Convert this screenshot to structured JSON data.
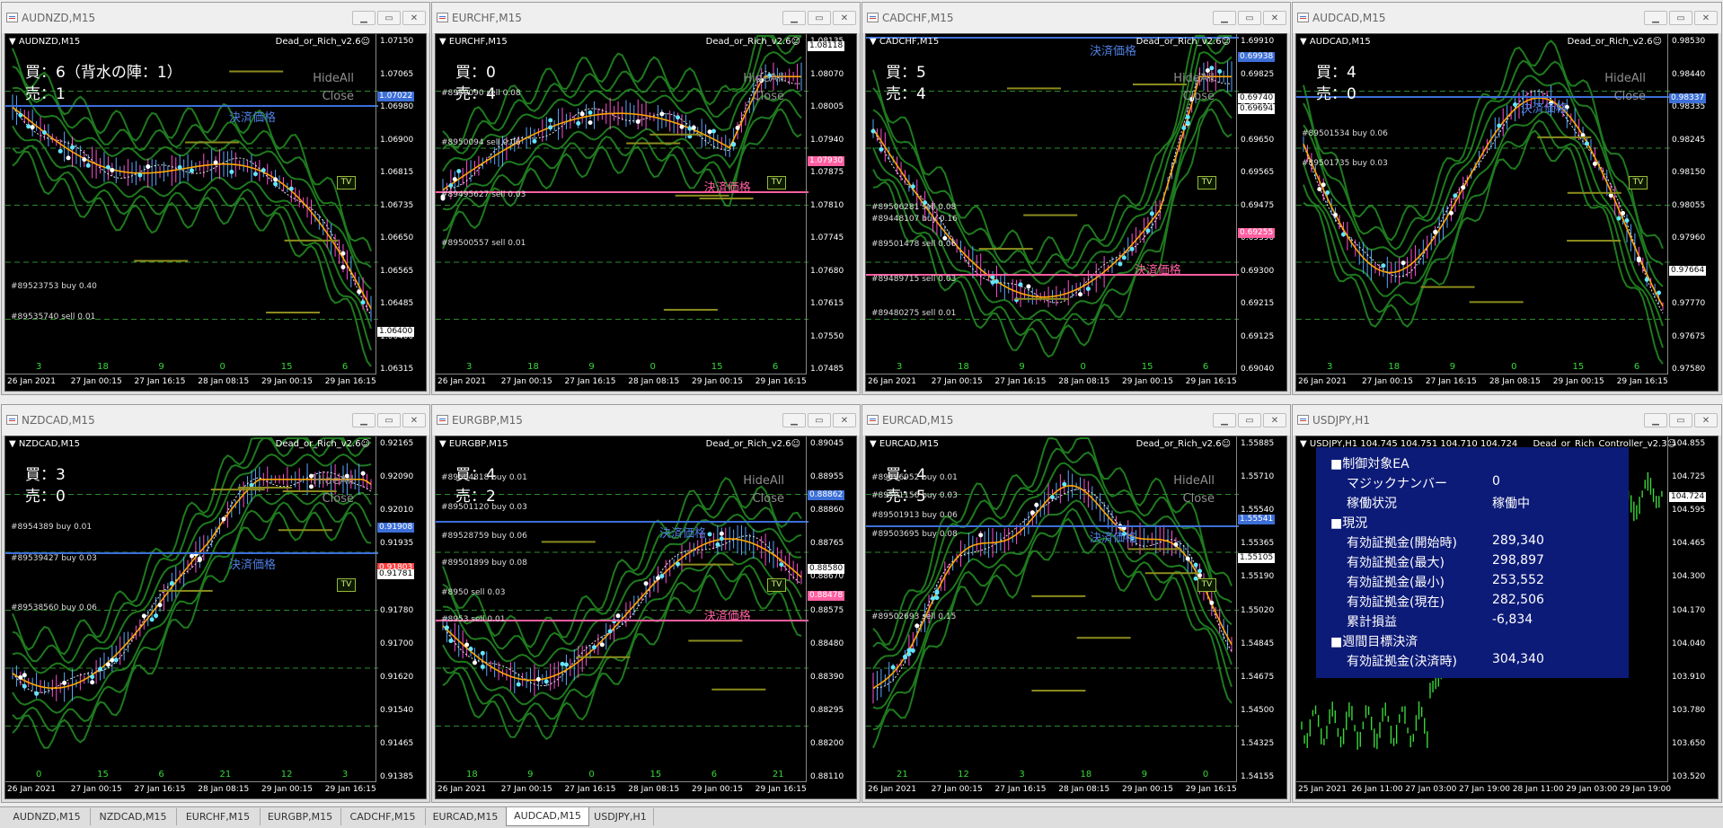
{
  "windows": [
    {
      "key": "w1",
      "title": "AUDNZD,M15",
      "symbol": "AUDNZD,M15",
      "ea": "Dead_or_Rich_v2.6☺",
      "buy": "買：6（背水の陣：1）",
      "sell": "売：1",
      "hide_all": "HideAll",
      "close": "Close",
      "tv": "TV",
      "settle_label": "決済価格",
      "pink_label": "",
      "orders": [
        "#89523753 buy 0.40",
        "#89535740 sell 0.01"
      ],
      "price_ticks": [
        "1.07150",
        "1.07065",
        "1.06980",
        "1.06900",
        "1.06815",
        "1.06735",
        "1.06650",
        "1.06565",
        "1.06485",
        "1.06400",
        "1.06315"
      ],
      "tags": [
        {
          "text": "1.07022",
          "color": "#3c6fd8"
        },
        {
          "text": "1.06400",
          "color": "#ffffff"
        }
      ],
      "hnums": [
        "3",
        "18",
        "9",
        "0",
        "15",
        "6"
      ],
      "dates": [
        "26 Jan 2021",
        "27 Jan 00:15",
        "27 Jan 16:15",
        "28 Jan 08:15",
        "29 Jan 00:15",
        "29 Jan 16:15"
      ],
      "trend": "down"
    },
    {
      "key": "w2",
      "title": "EURCHF,M15",
      "symbol": "EURCHF,M15",
      "ea": "Dead_or_Rich_v2.6☺",
      "buy": "買：0",
      "sell": "売：4",
      "hide_all": "HideAll",
      "close": "Close",
      "tv": "TV",
      "settle_label": "",
      "pink_label": "決済価格",
      "orders": [
        "#8950090 sell 0.08",
        "#8950094 sell 0.06",
        "#89495627 sell 0.03",
        "#89500557 sell 0.01"
      ],
      "price_ticks": [
        "1.08135",
        "1.08070",
        "1.08005",
        "1.07940",
        "1.07875",
        "1.07810",
        "1.07745",
        "1.07680",
        "1.07615",
        "1.07550",
        "1.07485"
      ],
      "tags": [
        {
          "text": "1.08118",
          "color": "#ffffff"
        },
        {
          "text": "1.07930",
          "color": "#ff5fa0"
        }
      ],
      "hnums": [
        "3",
        "18",
        "9",
        "0",
        "15",
        "6"
      ],
      "dates": [
        "26 Jan 2021",
        "27 Jan 00:15",
        "27 Jan 16:15",
        "28 Jan 08:15",
        "29 Jan 00:15",
        "29 Jan 16:15"
      ],
      "trend": "updown"
    },
    {
      "key": "w3",
      "title": "CADCHF,M15",
      "symbol": "CADCHF,M15",
      "ea": "Dead_or_Rich_v2.6☺",
      "buy": "買：5",
      "sell": "売：4",
      "hide_all": "HideAll",
      "close": "Close",
      "tv": "TV",
      "settle_label": "決済価格",
      "pink_label": "決済価格",
      "orders": [
        "#89506281 sell 0.08",
        "#89448107 buy 0.16",
        "#89501478 sell 0.06",
        "#89489715 sell 0.03",
        "#89480275 sell 0.01"
      ],
      "price_ticks": [
        "1.69910",
        "0.69825",
        "0.69740",
        "0.69650",
        "0.69565",
        "0.69475",
        "0.69390",
        "0.69300",
        "0.69215",
        "0.69125",
        "0.69040"
      ],
      "tags": [
        {
          "text": "0.69938",
          "color": "#3c6fd8"
        },
        {
          "text": "0.69740",
          "color": "#ffffff"
        },
        {
          "text": "0.69694",
          "color": "#ffffff"
        },
        {
          "text": "0.69255",
          "color": "#ff5fa0"
        }
      ],
      "hnums": [
        "3",
        "18",
        "9",
        "0",
        "15",
        "6"
      ],
      "dates": [
        "26 Jan 2021",
        "27 Jan 00:15",
        "27 Jan 16:15",
        "28 Jan 08:15",
        "29 Jan 00:15",
        "29 Jan 16:15"
      ],
      "trend": "vshape"
    },
    {
      "key": "w4",
      "title": "AUDCAD,M15",
      "symbol": "AUDCAD,M15",
      "ea": "Dead_or_Rich_v2.6☺",
      "buy": "買：4",
      "sell": "売：0",
      "hide_all": "HideAll",
      "close": "Close",
      "tv": "TV",
      "settle_label": "決済価格",
      "pink_label": "",
      "orders": [
        "#89501534 buy 0.06",
        "#89501735 buy 0.03"
      ],
      "price_ticks": [
        "0.98530",
        "0.98440",
        "0.98335",
        "0.98245",
        "0.98150",
        "0.98055",
        "0.97960",
        "0.97865",
        "0.97770",
        "0.97675",
        "0.97580"
      ],
      "tags": [
        {
          "text": "0.98337",
          "color": "#3c6fd8"
        },
        {
          "text": "0.97664",
          "color": "#ffffff"
        }
      ],
      "hnums": [
        "3",
        "18",
        "9",
        "0",
        "15",
        "6"
      ],
      "dates": [
        "26 Jan 2021",
        "27 Jan 00:15",
        "27 Jan 16:15",
        "28 Jan 08:15",
        "29 Jan 00:15",
        "29 Jan 16:15"
      ],
      "trend": "wave"
    },
    {
      "key": "w5",
      "title": "NZDCAD,M15",
      "symbol": "NZDCAD,M15",
      "ea": "Dead_or_Rich_v2.6☺",
      "buy": "買：3",
      "sell": "売：0",
      "hide_all": "HideAll",
      "close": "Close",
      "tv": "TV",
      "settle_label": "決済価格",
      "pink_label": "",
      "orders": [
        "#8954389 buy 0.01",
        "#89539427 buy 0.03",
        "#89538560 buy 0.06"
      ],
      "price_ticks": [
        "0.92165",
        "0.92090",
        "0.92010",
        "0.91935",
        "0.91855",
        "0.91780",
        "0.91700",
        "0.91620",
        "0.91540",
        "0.91465",
        "0.91385"
      ],
      "tags": [
        {
          "text": "0.91908",
          "color": "#3c6fd8"
        },
        {
          "text": "0.91803",
          "color": "#ff4040"
        },
        {
          "text": "0.91781",
          "color": "#ffffff"
        }
      ],
      "hnums": [
        "0",
        "15",
        "6",
        "21",
        "12",
        "3"
      ],
      "dates": [
        "26 Jan 2021",
        "27 Jan 00:15",
        "27 Jan 16:15",
        "28 Jan 08:15",
        "29 Jan 00:15",
        "29 Jan 16:15"
      ],
      "trend": "upcurve"
    },
    {
      "key": "w6",
      "title": "EURGBP,M15",
      "symbol": "EURGBP,M15",
      "ea": "Dead_or_Rich_v2.6☺",
      "buy": "買：4",
      "sell": "売：2",
      "hide_all": "HideAll",
      "close": "Close",
      "tv": "TV",
      "settle_label": "決済価格",
      "pink_label": "決済価格",
      "orders": [
        "#89504818 buy 0.01",
        "#89501120 buy 0.03",
        "#89528759 buy 0.06",
        "#89501899 buy 0.08",
        "#8950 sell 0.03",
        "#8953 sell 0.01"
      ],
      "price_ticks": [
        "0.89045",
        "0.88955",
        "0.88860",
        "0.88765",
        "0.88670",
        "0.88575",
        "0.88480",
        "0.88390",
        "0.88295",
        "0.88200",
        "0.88110"
      ],
      "tags": [
        {
          "text": "0.88862",
          "color": "#3c6fd8"
        },
        {
          "text": "0.88580",
          "color": "#ffffff"
        },
        {
          "text": "0.88478",
          "color": "#ff5fa0"
        }
      ],
      "hnums": [
        "18",
        "9",
        "0",
        "15",
        "6",
        "21"
      ],
      "dates": [
        "26 Jan 2021",
        "27 Jan 00:15",
        "27 Jan 16:15",
        "28 Jan 08:15",
        "29 Jan 00:15",
        "29 Jan 16:15"
      ],
      "trend": "bowl"
    },
    {
      "key": "w7",
      "title": "EURCAD,M15",
      "symbol": "EURCAD,M15",
      "ea": "Dead_or_Rich_v2.6☺",
      "buy": "買：4",
      "sell": "売：5",
      "hide_all": "HideAll",
      "close": "Close",
      "tv": "TV",
      "settle_label": "決済価格",
      "pink_label": "",
      "orders": [
        "#89496952 buy 0.01",
        "#89501156 buy 0.03",
        "#89501913 buy 0.06",
        "#89503695 buy 0.08",
        "#89502693 sell 0.15"
      ],
      "price_ticks": [
        "1.55885",
        "1.55710",
        "1.55540",
        "1.55365",
        "1.55190",
        "1.55020",
        "1.54845",
        "1.54675",
        "1.54500",
        "1.54325",
        "1.54155"
      ],
      "tags": [
        {
          "text": "1.55541",
          "color": "#3c6fd8"
        },
        {
          "text": "1.55105",
          "color": "#ffffff"
        }
      ],
      "hnums": [
        "21",
        "12",
        "3",
        "18",
        "9",
        "0"
      ],
      "dates": [
        "26 Jan 2021",
        "27 Jan 00:15",
        "27 Jan 16:15",
        "28 Jan 08:15",
        "29 Jan 00:15",
        "29 Jan 16:15"
      ],
      "trend": "upmid"
    }
  ],
  "controller": {
    "title": "USDJPY,H1",
    "symbol": "USDJPY,H1  104.745 104.751 104.710 104.724",
    "ea": "Dead_or_Rich_Controller_v2.3☺",
    "price_ticks": [
      "104.855",
      "104.725",
      "104.595",
      "104.465",
      "104.300",
      "104.170",
      "104.040",
      "103.910",
      "103.780",
      "103.650",
      "103.520"
    ],
    "tag": "104.724",
    "dates": [
      "25 Jan 2021",
      "26 Jan 11:00",
      "27 Jan 03:00",
      "27 Jan 19:00",
      "28 Jan 11:00",
      "29 Jan 03:00",
      "29 Jan 19:00"
    ],
    "panel": {
      "h1": "■制御対象EA",
      "magic_label": "マジックナンバー",
      "magic_value": "0",
      "status_label": "稼働状況",
      "status_value": "稼働中",
      "h2": "■現況",
      "eq_start_label": "有効証拠金(開始時)",
      "eq_start": "289,340",
      "eq_max_label": "有効証拠金(最大)",
      "eq_max": "298,897",
      "eq_min_label": "有効証拠金(最小)",
      "eq_min": "253,552",
      "eq_now_label": "有効証拠金(現在)",
      "eq_now": "282,506",
      "pl_label": "累計損益",
      "pl": "-6,834",
      "h3": "■週間目標決済",
      "eq_target_label": "有効証拠金(決済時)",
      "eq_target": "304,340"
    }
  },
  "tabs": [
    "AUDNZD,M15",
    "NZDCAD,M15",
    "EURCHF,M15",
    "EURGBP,M15",
    "CADCHF,M15",
    "EURCAD,M15",
    "AUDCAD,M15",
    "USDJPY,H1"
  ],
  "active_tab": "AUDCAD,M15",
  "colors": {
    "settle": "#3c6fd8",
    "pink": "#ff5fa0",
    "band": "#1e7a1e",
    "ma": "#ffa500",
    "panel": "#0d1b78"
  }
}
